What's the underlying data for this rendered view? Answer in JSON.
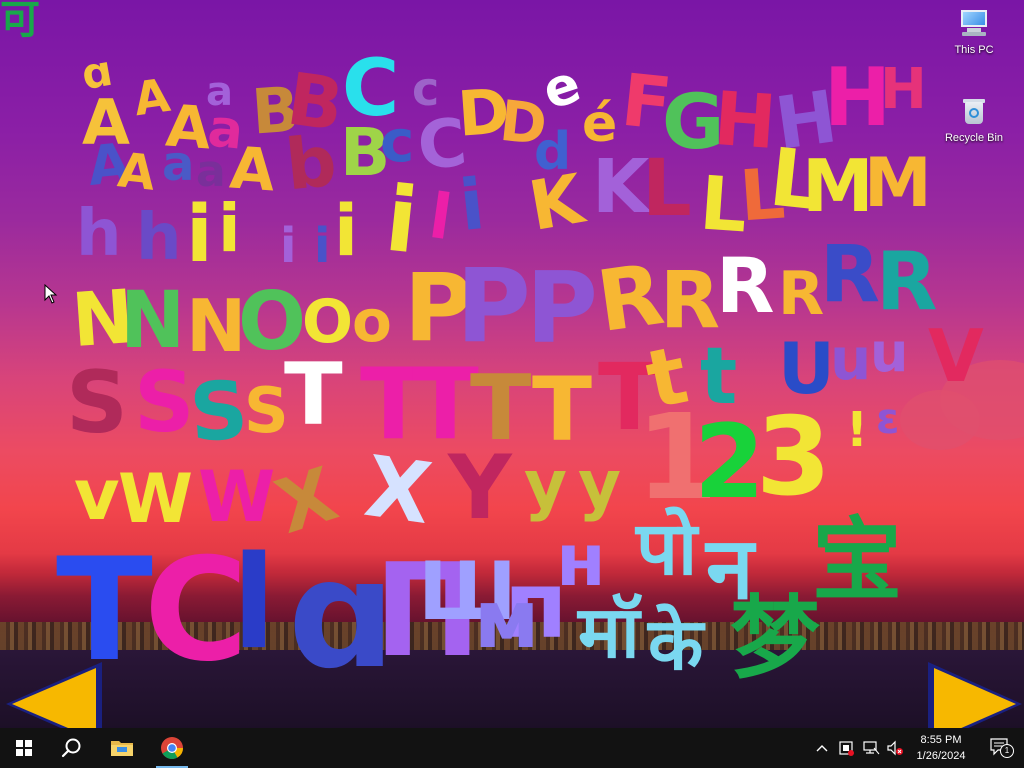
{
  "desktop": {
    "icons": [
      {
        "label": "This PC",
        "icon": "this-pc-icon"
      },
      {
        "label": "Recycle Bin",
        "icon": "recycle-bin-icon"
      }
    ]
  },
  "wallpaper": {
    "glyphs": [
      {
        "t": "ɑ",
        "c": "#f6c23a"
      },
      {
        "t": "A",
        "c": "#f6c23a"
      },
      {
        "t": "A",
        "c": "#f7b733"
      },
      {
        "t": "A",
        "c": "#f7b733"
      },
      {
        "t": "a",
        "c": "#a361d9"
      },
      {
        "t": "a",
        "c": "#e02a9c"
      },
      {
        "t": "B",
        "c": "#c7893a"
      },
      {
        "t": "B",
        "c": "#c0265f"
      },
      {
        "t": "C",
        "c": "#29e0ec"
      },
      {
        "t": "c",
        "c": "#9d63c9"
      },
      {
        "t": "D",
        "c": "#f7b733"
      },
      {
        "t": "D",
        "c": "#f7a73a"
      },
      {
        "t": "e",
        "c": "#ffffff"
      },
      {
        "t": "é",
        "c": "#f7b733"
      },
      {
        "t": "F",
        "c": "#ef3a6b"
      },
      {
        "t": "G",
        "c": "#50c25a"
      },
      {
        "t": "H",
        "c": "#e2295f"
      },
      {
        "t": "H",
        "c": "#8e55d4"
      },
      {
        "t": "H",
        "c": "#ec1fa8"
      },
      {
        "t": "H",
        "c": "#e6327a"
      },
      {
        "t": "A",
        "c": "#4a52c9"
      },
      {
        "t": "A",
        "c": "#f7b733"
      },
      {
        "t": "a",
        "c": "#4a5ac7"
      },
      {
        "t": "a",
        "c": "#7a2f9a"
      },
      {
        "t": "A",
        "c": "#f7b733"
      },
      {
        "t": "b",
        "c": "#b02a5a"
      },
      {
        "t": "B",
        "c": "#9fd448"
      },
      {
        "t": "c",
        "c": "#3a5cc8"
      },
      {
        "t": "C",
        "c": "#a463d8"
      },
      {
        "t": "d",
        "c": "#4060d0"
      },
      {
        "t": "h",
        "c": "#8e55d4"
      },
      {
        "t": "h",
        "c": "#6a4ac7"
      },
      {
        "t": "i",
        "c": "#f2e535"
      },
      {
        "t": "i",
        "c": "#f2e535"
      },
      {
        "t": "i",
        "c": "#a361d9"
      },
      {
        "t": "i",
        "c": "#4a52c9"
      },
      {
        "t": "i",
        "c": "#f2e535"
      },
      {
        "t": "i",
        "c": "#f2e535"
      },
      {
        "t": "l",
        "c": "#ec1fa8"
      },
      {
        "t": "i",
        "c": "#4a52c9"
      },
      {
        "t": "K",
        "c": "#f7b733"
      },
      {
        "t": "K",
        "c": "#a361d9"
      },
      {
        "t": "L",
        "c": "#c0265f"
      },
      {
        "t": "L",
        "c": "#f2e535"
      },
      {
        "t": "L",
        "c": "#ef6a3a"
      },
      {
        "t": "L",
        "c": "#f2e535"
      },
      {
        "t": "M",
        "c": "#f2e535"
      },
      {
        "t": "M",
        "c": "#f7b733"
      },
      {
        "t": "N",
        "c": "#f2e535"
      },
      {
        "t": "N",
        "c": "#50c25a"
      },
      {
        "t": "N",
        "c": "#f7b733"
      },
      {
        "t": "O",
        "c": "#50c25a"
      },
      {
        "t": "O",
        "c": "#f2e535"
      },
      {
        "t": "o",
        "c": "#f7b733"
      },
      {
        "t": "P",
        "c": "#f7b733"
      },
      {
        "t": "P",
        "c": "#8e55d4"
      },
      {
        "t": "P",
        "c": "#8e55d4"
      },
      {
        "t": "R",
        "c": "#f7b733"
      },
      {
        "t": "R",
        "c": "#f7b733"
      },
      {
        "t": "R",
        "c": "#ffffff"
      },
      {
        "t": "R",
        "c": "#f7b733"
      },
      {
        "t": "R",
        "c": "#3a4cc8"
      },
      {
        "t": "R",
        "c": "#1aa6a0"
      },
      {
        "t": "S",
        "c": "#b02a5a"
      },
      {
        "t": "S",
        "c": "#ec1fa8"
      },
      {
        "t": "S",
        "c": "#1aa6a0"
      },
      {
        "t": "S",
        "c": "#f7b733"
      },
      {
        "t": "T",
        "c": "#ffffff"
      },
      {
        "t": "T",
        "c": "#ec1fa8"
      },
      {
        "t": "T",
        "c": "#ec1fa8"
      },
      {
        "t": "T",
        "c": "#c7893a"
      },
      {
        "t": "T",
        "c": "#f7b733"
      },
      {
        "t": "T",
        "c": "#e2295f"
      },
      {
        "t": "t",
        "c": "#f7b733"
      },
      {
        "t": "t",
        "c": "#1aa6a0"
      },
      {
        "t": "U",
        "c": "#2a4cc8"
      },
      {
        "t": "u",
        "c": "#8e55d4"
      },
      {
        "t": "u",
        "c": "#a361d9"
      },
      {
        "t": "V",
        "c": "#e2295f"
      },
      {
        "t": "1",
        "c": "#f07070"
      },
      {
        "t": "2",
        "c": "#18d23a"
      },
      {
        "t": "3",
        "c": "#f2e535"
      },
      {
        "t": "!",
        "c": "#f2e535"
      },
      {
        "t": "ɛ",
        "c": "#8e55d4"
      },
      {
        "t": "v",
        "c": "#f2e535"
      },
      {
        "t": "W",
        "c": "#f2e535"
      },
      {
        "t": "W",
        "c": "#ec1fa8"
      },
      {
        "t": "X",
        "c": "#c7893a"
      },
      {
        "t": "X",
        "c": "#d6e2ff"
      },
      {
        "t": "Y",
        "c": "#c0265f"
      },
      {
        "t": "y",
        "c": "#c7c03a"
      },
      {
        "t": "y",
        "c": "#c7c03a"
      },
      {
        "t": "T",
        "c": "#2a4cf0"
      },
      {
        "t": "C",
        "c": "#ec1fa8"
      },
      {
        "t": "l",
        "c": "#2a3cc8"
      },
      {
        "t": "ɑ",
        "c": "#3a4ac8"
      },
      {
        "t": "П",
        "c": "#a463f0"
      },
      {
        "t": "Ш",
        "c": "#9fa0ff"
      },
      {
        "t": "п",
        "c": "#a080ff"
      },
      {
        "t": "м",
        "c": "#8a7af0"
      },
      {
        "t": "н",
        "c": "#a080ff"
      },
      {
        "t": "पो",
        "c": "#7ad8f0"
      },
      {
        "t": "मॉ",
        "c": "#7ad8f0"
      },
      {
        "t": "के",
        "c": "#7ad8f0"
      },
      {
        "t": "न",
        "c": "#7ad8f0"
      },
      {
        "t": "宝",
        "c": "#18a84a"
      },
      {
        "t": "梦",
        "c": "#18a84a"
      },
      {
        "t": "可",
        "c": "#18a84a"
      }
    ]
  },
  "nav": {
    "left_arrow": "previous-arrow-icon",
    "right_arrow": "next-arrow-icon",
    "arrow_color": "#f7b800",
    "arrow_outline": "#1a2080"
  },
  "taskbar": {
    "start": "start-icon",
    "search": "search-icon",
    "apps": [
      {
        "name": "File Explorer",
        "icon": "file-explorer-icon"
      },
      {
        "name": "Google Chrome",
        "icon": "chrome-icon",
        "active": true
      }
    ],
    "tray": {
      "chevron": "show-hidden-icons-icon",
      "time": "8:55 PM",
      "date": "1/26/2024",
      "notification_count": "1"
    }
  }
}
